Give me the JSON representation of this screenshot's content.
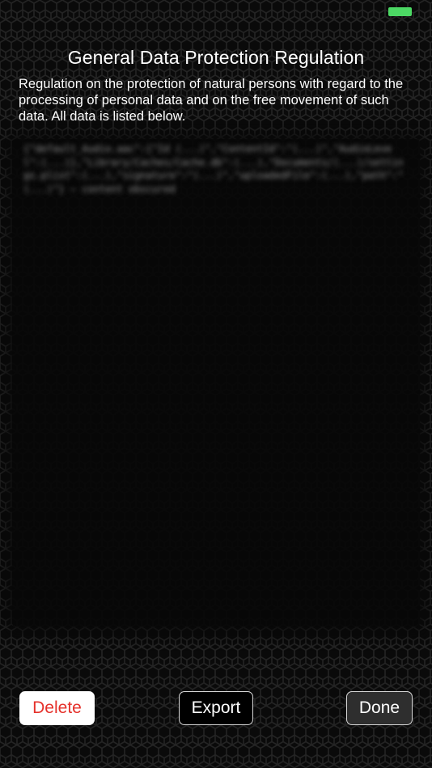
{
  "status_bar": {
    "battery_color": "#4cd964",
    "battery_icon": "battery-icon"
  },
  "header": {
    "title": "General Data Protection Regulation",
    "description": "Regulation on the protection of natural persons with regard to the processing of personal data and on the free movement of such data. All data is listed below."
  },
  "data_panel": {
    "content": "{\"default_Audio.aac\":{\"Id (...)\",\"ContentId\":\"(...)\",\"AudioLevel\":(...)},\"Library/Caches/Cache.db\":(...),\"Documents/(...)/settings.plist\":(...),\"signature\":\"(...)\",\"uploadedFile\":(...),\"path\":\"(...)\"} — content obscured"
  },
  "actions": {
    "delete_label": "Delete",
    "export_label": "Export",
    "done_label": "Done",
    "delete_color": "#e5312b"
  }
}
